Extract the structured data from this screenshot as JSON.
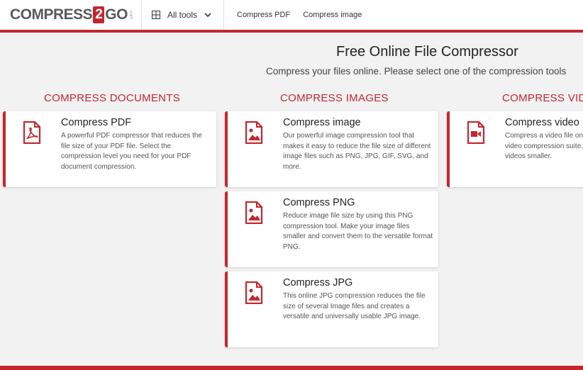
{
  "header": {
    "logo": {
      "left": "COMPRESS",
      "num": "2",
      "right": "GO",
      "suffix": ".com"
    },
    "all_tools_label": "All tools",
    "nav": [
      "Compress PDF",
      "Compress image"
    ]
  },
  "hero": {
    "title": "Free Online File Compressor",
    "subtitle": "Compress your files online. Please select one of the compression tools"
  },
  "sections": {
    "documents": "COMPRESS DOCUMENTS",
    "images": "COMPRESS IMAGES",
    "video": "COMPRESS VIDEO"
  },
  "cards": {
    "pdf": {
      "title": "Compress PDF",
      "desc": "A powerful PDF compressor that reduces the file size of your PDF file. Select the compression level you need for your PDF document compression."
    },
    "image": {
      "title": "Compress image",
      "desc": "Our powerful image compression tool that makes it easy to reduce the file size of different image files such as PNG, JPG, GIF, SVG, and more."
    },
    "png": {
      "title": "Compress PNG",
      "desc": "Reduce image file size by using this PNG compression tool. Make your image files smaller and convert them to the versatile format PNG."
    },
    "jpg": {
      "title": "Compress JPG",
      "desc": "This online JPG compression reduces the file size of several Image files and creates a versatile and universally usable JPG image."
    },
    "video": {
      "title": "Compress video",
      "desc": "Compress a video file online with this video compression suite. Make your videos smaller."
    }
  },
  "colors": {
    "accent": "#c4262e",
    "background": "#f2f2f2",
    "card": "#ffffff"
  }
}
